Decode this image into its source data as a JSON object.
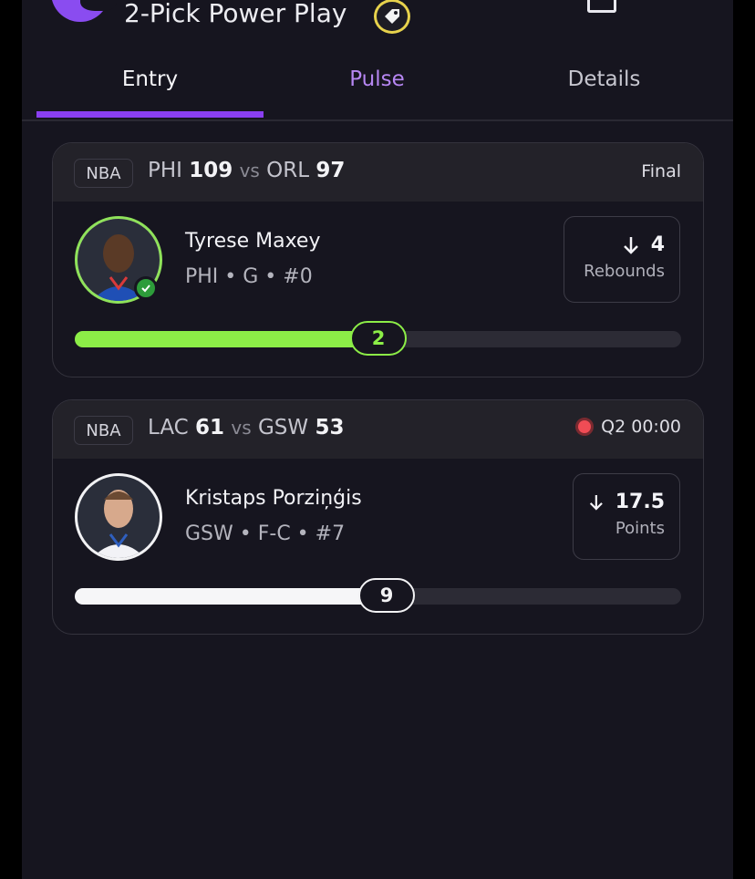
{
  "header": {
    "title": "2-Pick Power Play"
  },
  "tabs": [
    {
      "label": "Entry"
    },
    {
      "label": "Pulse"
    },
    {
      "label": "Details"
    }
  ],
  "picks": [
    {
      "league": "NBA",
      "away_team": "PHI",
      "away_score": "109",
      "vs": "vs",
      "home_team": "ORL",
      "home_score": "97",
      "status": "Final",
      "player_name": "Tyrese Maxey",
      "player_meta": "PHI • G • #0",
      "line_value": "4",
      "line_stat": "Rebounds",
      "current_value": "2",
      "progress_fraction": 0.5
    },
    {
      "league": "NBA",
      "away_team": "LAC",
      "away_score": "61",
      "vs": "vs",
      "home_team": "GSW",
      "home_score": "53",
      "status": "Q2 00:00",
      "player_name": "Kristaps Porziņģis",
      "player_meta": "GSW • F-C • #7",
      "line_value": "17.5",
      "line_stat": "Points",
      "current_value": "9",
      "progress_fraction": 0.514
    }
  ],
  "colors": {
    "accent": "#8a3ff1",
    "success": "#8ced47",
    "live": "#f04c55"
  }
}
